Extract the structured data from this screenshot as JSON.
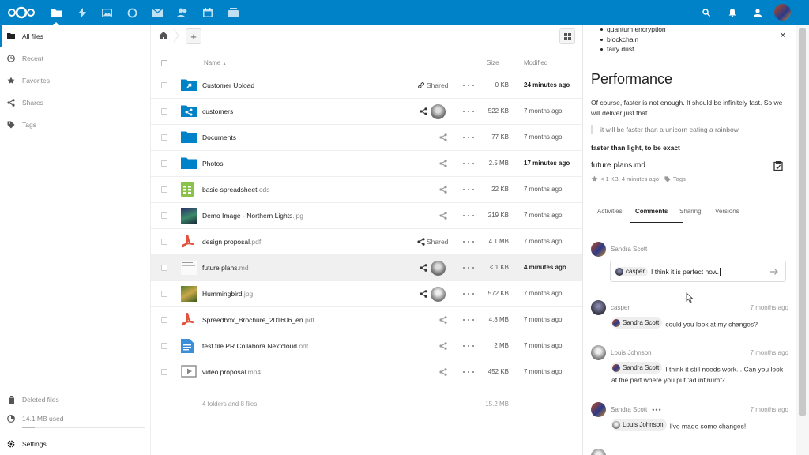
{
  "sidebar": {
    "items": [
      {
        "label": "All files",
        "icon": "folder-icon"
      },
      {
        "label": "Recent",
        "icon": "clock-icon"
      },
      {
        "label": "Favorites",
        "icon": "star-icon"
      },
      {
        "label": "Shares",
        "icon": "share-icon"
      },
      {
        "label": "Tags",
        "icon": "tag-icon"
      }
    ],
    "deleted_label": "Deleted files",
    "quota_label": "14.1 MB used",
    "quota_fraction": 0.1,
    "settings_label": "Settings"
  },
  "table": {
    "header": {
      "name": "Name",
      "name_sort": "▲",
      "size": "Size",
      "modified": "Modified"
    },
    "rows": [
      {
        "base": "Customer Upload",
        "ext": "",
        "size": "0 KB",
        "modified": "24 minutes ago",
        "shared_label": "Shared",
        "icon": "folder-link-icon"
      },
      {
        "base": "customers",
        "ext": "",
        "size": "522 KB",
        "modified": "7 months ago",
        "shared_label": "",
        "icon": "folder-shared-icon"
      },
      {
        "base": "Documents",
        "ext": "",
        "size": "77 KB",
        "modified": "7 months ago",
        "shared_label": "",
        "icon": "folder-icon"
      },
      {
        "base": "Photos",
        "ext": "",
        "size": "2.5 MB",
        "modified": "17 minutes ago",
        "shared_label": "",
        "icon": "folder-icon"
      },
      {
        "base": "basic-spreadsheet",
        "ext": ".ods",
        "size": "22 KB",
        "modified": "7 months ago",
        "shared_label": "",
        "icon": "spreadsheet-icon"
      },
      {
        "base": "Demo Image - Northern Lights",
        "ext": ".jpg",
        "size": "219 KB",
        "modified": "7 months ago",
        "shared_label": "",
        "icon": "image-thumbnail"
      },
      {
        "base": "design proposal",
        "ext": ".pdf",
        "size": "4.1 MB",
        "modified": "7 months ago",
        "shared_label": "Shared",
        "icon": "pdf-icon"
      },
      {
        "base": "future plans",
        "ext": ".md",
        "size": "< 1 KB",
        "modified": "4 minutes ago",
        "shared_label": "",
        "icon": "text-thumbnail"
      },
      {
        "base": "Hummingbird",
        "ext": ".jpg",
        "size": "572 KB",
        "modified": "7 months ago",
        "shared_label": "",
        "icon": "image-thumbnail"
      },
      {
        "base": "Spreedbox_Brochure_201606_en",
        "ext": ".pdf",
        "size": "4.8 MB",
        "modified": "7 months ago",
        "shared_label": "",
        "icon": "pdf-icon"
      },
      {
        "base": "test file PR Collabora Nextcloud",
        "ext": ".odt",
        "size": "2 MB",
        "modified": "7 months ago",
        "shared_label": "",
        "icon": "document-icon"
      },
      {
        "base": "video proposal",
        "ext": ".mp4",
        "size": "452 KB",
        "modified": "7 months ago",
        "shared_label": "",
        "icon": "video-icon"
      }
    ],
    "summary": {
      "counts": "4 folders and 8 files",
      "total": "15.2 MB"
    }
  },
  "details": {
    "list": [
      "quantum encryption",
      "blockchain",
      "fairy dust"
    ],
    "heading": "Performance",
    "paragraph_1": "Of course, faster is not enough. It should be infinitely fast. So we",
    "paragraph_2": "will deliver just that.",
    "quote": "it will be faster than a unicorn eating a rainbow",
    "bold_line": "faster than light, to be exact",
    "file_title": "future plans.md",
    "meta_size": "< 1 KB, 4 minutes ago",
    "meta_tags": "Tags",
    "tabs": [
      "Activities",
      "Comments",
      "Sharing",
      "Versions"
    ],
    "new_comment": {
      "author": "Sandra Scott",
      "mention": "casper",
      "text": "I think it is perfect now."
    },
    "comments": [
      {
        "author": "casper",
        "time": "7 months ago",
        "mention": "Sandra Scott",
        "text": "could you look at my changes?",
        "text2": ""
      },
      {
        "author": "Louis Johnson",
        "time": "7 months ago",
        "mention": "Sandra Scott",
        "text": "I think it still needs work... Can you look",
        "text2": "at the part where you put 'ad infinum'?"
      },
      {
        "author": "Sandra Scott",
        "time": "7 months ago",
        "mention": "Louis Johnson",
        "text": "I've made some changes!",
        "text2": ""
      }
    ]
  },
  "colors": {
    "brand": "#0082c9",
    "folder": "#0082c9",
    "pdf": "#e2523d",
    "spreadsheet": "#8bc34a"
  }
}
